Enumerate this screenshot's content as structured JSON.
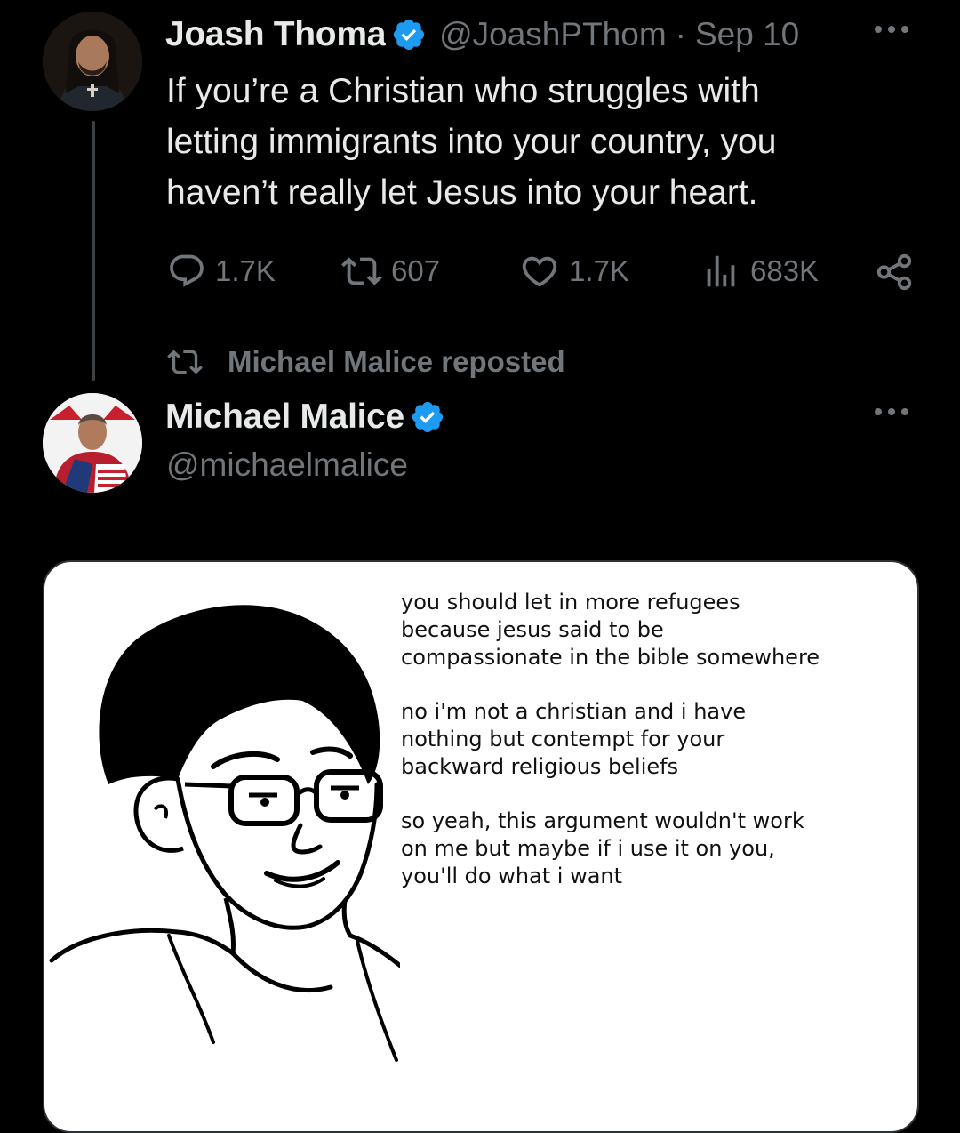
{
  "original_tweet": {
    "author_name": "Joash Thoma",
    "handle": "@JoashPThom",
    "separator": "·",
    "date": "Sep 10",
    "more_icon": "more-horizontal-icon",
    "text": "If you’re a Christian who struggles with\nletting immigrants into your country, you\nhaven’t really let Jesus into your heart.",
    "stats": {
      "replies": "1.7K",
      "reposts": "607",
      "likes": "1.7K",
      "views": "683K"
    }
  },
  "repost_notice": {
    "text": "Michael Malice reposted",
    "icon": "repost-icon"
  },
  "repost_tweet": {
    "author_name": "Michael Malice",
    "handle": "@michaelmalice",
    "more_icon": "more-horizontal-icon",
    "meme_text": [
      "you should let in more refugees\nbecause jesus said to be\ncompassionate in the bible somewhere",
      "no i'm not a christian and i have\nnothing but contempt for your\nbackward religious beliefs",
      "so yeah, this argument wouldn't work\non me but maybe if i use it on you,\nyou'll do what i want"
    ]
  },
  "colors": {
    "background": "#000000",
    "primary_text": "#e7e9ea",
    "secondary_text": "#71767b",
    "verified_blue": "#1d9bf0",
    "thread_line": "#3e4144"
  }
}
